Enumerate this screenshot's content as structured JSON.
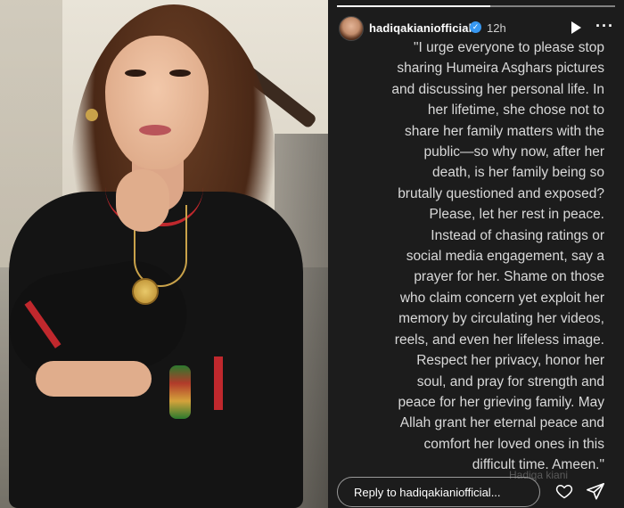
{
  "story": {
    "username": "hadiqakianiofficial",
    "time_ago": "12h",
    "progress": 0.55,
    "quote_text": "\"I urge everyone to please stop\nsharing Humeira Asghars pictures\nand discussing her personal life. In\nher lifetime, she chose not to\nshare her family matters with the\npublic—so why now, after her\ndeath, is her family being so\nbrutally questioned and exposed?\nPlease, let her rest in peace.\nInstead of chasing ratings or\nsocial media engagement, say a\nprayer for her. Shame on those\nwho claim concern yet exploit her\nmemory by circulating her videos,\nreels, and even her lifeless image.\nRespect her privacy, honor her\nsoul, and pray for strength and\npeace for her grieving family. May\nAllah grant her eternal peace and\ncomfort her loved ones in this\ndifficult time. Ameen.\"",
    "watermark": "Hadiqa kiani",
    "reply_placeholder": "Reply to hadiqakianiofficial...",
    "icons": {
      "verified": "verified-badge-icon",
      "play": "play-icon",
      "more": "more-icon",
      "heart": "heart-icon",
      "send": "send-icon"
    },
    "colors": {
      "background": "#1c1c1c",
      "verified": "#3797f0",
      "text": "#d9d9d9"
    }
  }
}
